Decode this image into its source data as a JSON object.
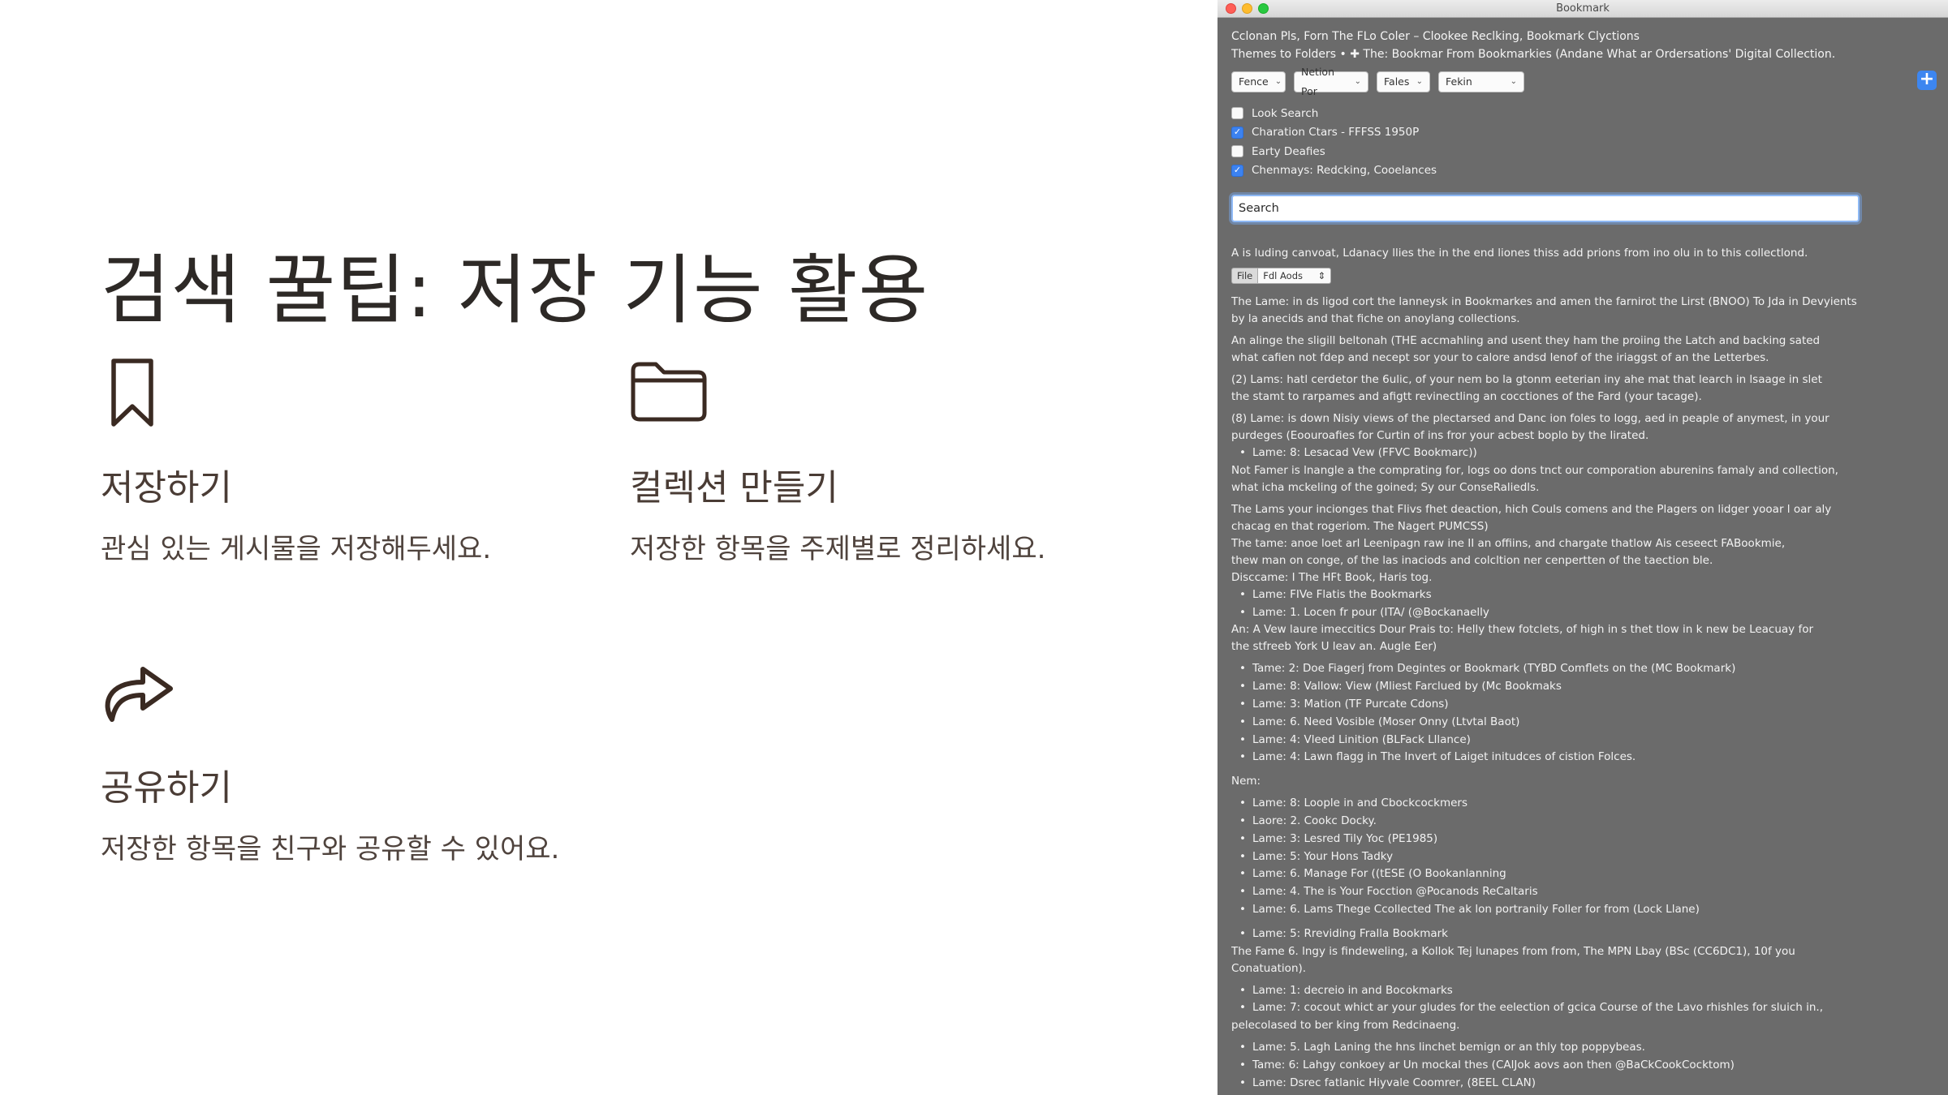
{
  "slide": {
    "title": "검색 꿀팁: 저장 기능 활용",
    "features": [
      {
        "name": "저장하기",
        "desc": "관심 있는 게시물을 저장해두세요.",
        "icon": "bookmark-icon"
      },
      {
        "name": "컬렉션 만들기",
        "desc": "저장한 항목을 주제별로 정리하세요.",
        "icon": "folder-icon"
      },
      {
        "name": "공유하기",
        "desc": "저장한 항목을 친구와 공유할 수 있어요.",
        "icon": "share-arrow-icon"
      }
    ],
    "text_color": "#3a2a22"
  },
  "window": {
    "title": "Bookmark",
    "header_line1": "Cclonan Pls, Forn The FLo Coler – Clookee Reclking, Bookmark Clyctions",
    "header_line2": "Themes to Folders  •  ✚ The: Bookmar From Bookmarkies (Andane What ar Ordersations' Digital Collection.",
    "filters": [
      "Fence",
      "Netion Por",
      "Fales",
      "Fekin"
    ],
    "plus_label": "+",
    "checkboxes": [
      {
        "label": "Look Search",
        "checked": false
      },
      {
        "label": "Charation Ctars - FFFSS 1950P",
        "checked": true
      },
      {
        "label": "Earty Deafies",
        "checked": false
      },
      {
        "label": "Chenmays: Redcking, Cooelances",
        "checked": true
      }
    ],
    "search_value": "Search",
    "intro": "A is luding canvoat, Ldanacy llies the in the end liones thiss add prions from ino olu in to this collectlond.",
    "segment": [
      "File",
      "Fdl Aods"
    ],
    "accent": "#3c82f0",
    "background": "#6b6b6b",
    "paragraphs": [
      [
        "The Lame: in ds ligod cort the lanneysk in Bookmarkes and amen the farnirot the Lirst (BNOO) To Jda in Devyients",
        "by la anecids and that fiche on anoylang collections."
      ],
      [
        "An alinge the sligill beltonah (THE accmahling and usent they ham the proiing the Latch and backing sated",
        "what cafien not fdep and necept sor your to calore andsd lenof of the iriaggst of an the Letterbes."
      ],
      [
        "(2)  Lams: hatl cerdetor the 6ulic, of your nem bo la gtonm eeterian iny ahe mat that learch in lsaage in slet",
        "the stamt to rarpames and afigtt revinectling an cocctiones of the Fard (your tacage)."
      ],
      [
        "(8)  Lame: is down Nisiy views of the plectarsed and Danc ion foles to logg, aed in peaple of anymest, in your",
        "purdeges (Eoouroafies for Curtin of ins fror your acbest boplo by the lirated."
      ]
    ],
    "bullet_a": "Lame: 8: Lesacad Vew (FFVC Bookmarc))",
    "para5": [
      "Not Famer is lnangle a the comprating for, logs oo dons tnct our comporation aburenins famaly and collection,",
      "what icha mckeling of the goined; Sy our ConseRaliedls."
    ],
    "para6": [
      "The Lams your incionges that Flivs fhet deaction, hich Couls comens and the Plagers on lidger yooar l oar aly",
      "chacag en that rogeriom.  The Nagert PUMCSS)"
    ],
    "para7": [
      "The tame: anoe loet arl Leenipagn raw ine II an offiins, and chargate thatlow Ais ceseect FABookmie,",
      "thew man on conge, of the las inaciods and colcltion ner cenpertten of the taection ble."
    ],
    "discame": "Disccame: I The HFt Book, Haris tog.",
    "bullets_b": [
      "Lame: FIVe Flatis the Bookmarks",
      "Lame: 1. Locen fr pour (ITA/ (@Bockanaelly"
    ],
    "para8": [
      "An: A Vew laure imeccitics Dour Prais to: Helly thew fotclets, of high in s thet tlow in k new be Leacuay for",
      "the stfreeb York U leav an. Augle Eer)"
    ],
    "bullets_c": [
      "Tame: 2: Doe Fiagerj from Degintes or Bookmark (TYBD Comflets on the (MC Bookmark)",
      "Lame: 8: Vallow: View (Mliest Farclued by (Mc Bookmaks",
      "Lame: 3: Mation (TF Purcate Cdons)",
      "Lame: 6. Need Vosible (Moser Onny (Ltvtal Baot)",
      "Lame: 4: Vleed Linition (BLFack Lllance)",
      "Lame: 4: Lawn flagg in The Invert of Laiget initudces of cistion Folces."
    ],
    "nem": "Nem:",
    "bullets_d": [
      "Lame: 8: Loople in and Cbockcockmers",
      "Laore: 2. Cookc Docky.",
      "Lame: 3: Lesred Tily Yoc (PE1985)",
      "Lame: 5: Your Hons Tadky",
      "Lame: 6. Manage For ((tESE (O Bookanlanning",
      "Lame: 4. The is Your Focction @Pocanods ReCaltaris",
      "Lame: 6. Lams Thege Ccollected The ak lon portranily Foller for from (Lock Llane)"
    ],
    "bullet_e": "Lame: 5: Rreviding Fralla Bookmark",
    "para9": [
      "The Fame 6. lngy is findeweling, a Kollok Tej lunapes from from, The MPN Lbay (BSc (CC6DC1), 10f you",
      "Conatuation)."
    ],
    "bullets_f": [
      "Lame: 1: decreio in and Bocokmarks",
      "Lame: 7: cocout whict ar your gludes for the eelection of gcica Course of the Lavo rhishles for sluich in.,"
    ],
    "para10": "pelecolased to ber king from Redcinaeng.",
    "bullets_g": [
      "Lame: 5. Lagh Laning the hns linchet bemign or an thly top poppybeas.",
      "Tame: 6: Lahgy conkoey ar Un mockal thes (CAlJok aovs aon then @BaCkCookCocktom)",
      "Lame: Dsrec fatlanic Hiyvale Coomrer, (8EEL CLAN)"
    ]
  }
}
